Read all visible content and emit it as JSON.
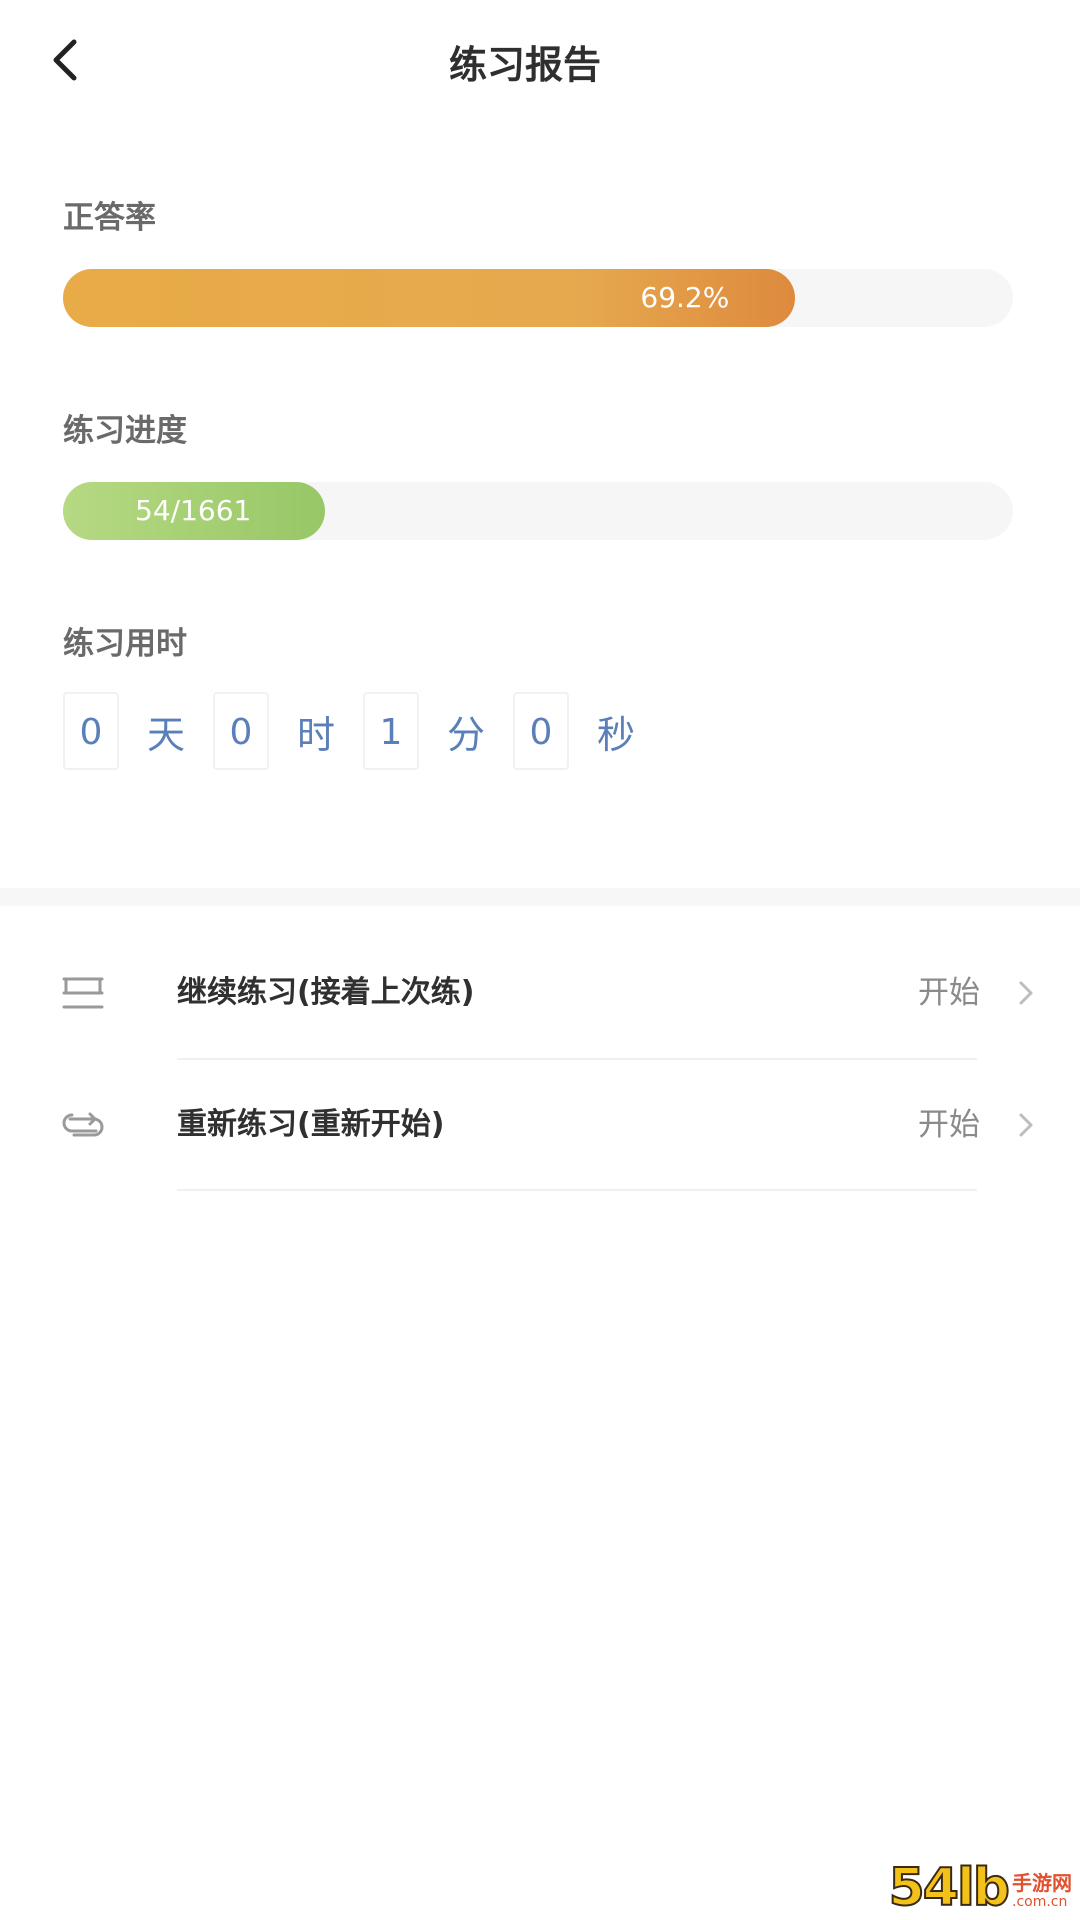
{
  "header": {
    "title": "练习报告"
  },
  "accuracy": {
    "label": "正答率",
    "value_text": "69.2%",
    "value": 0.692
  },
  "progress": {
    "label": "练习进度",
    "value_text": "54/1661",
    "completed": 54,
    "total": 1661
  },
  "time_used": {
    "label": "练习用时",
    "days": "0",
    "days_unit": "天",
    "hours": "0",
    "hours_unit": "时",
    "minutes": "1",
    "minutes_unit": "分",
    "seconds": "0",
    "seconds_unit": "秒"
  },
  "actions": [
    {
      "icon": "continue-icon",
      "label": "继续练习(接着上次练)",
      "action": "开始"
    },
    {
      "icon": "restart-icon",
      "label": "重新练习(重新开始)",
      "action": "开始"
    }
  ],
  "watermark": {
    "number": "54",
    "suffix": "lb",
    "name": "手游网",
    "domain": ".com.cn"
  },
  "colors": {
    "accuracy_fill": "#e9ab47",
    "progress_fill": "#a8cf76",
    "time_text": "#5b7fb8"
  }
}
